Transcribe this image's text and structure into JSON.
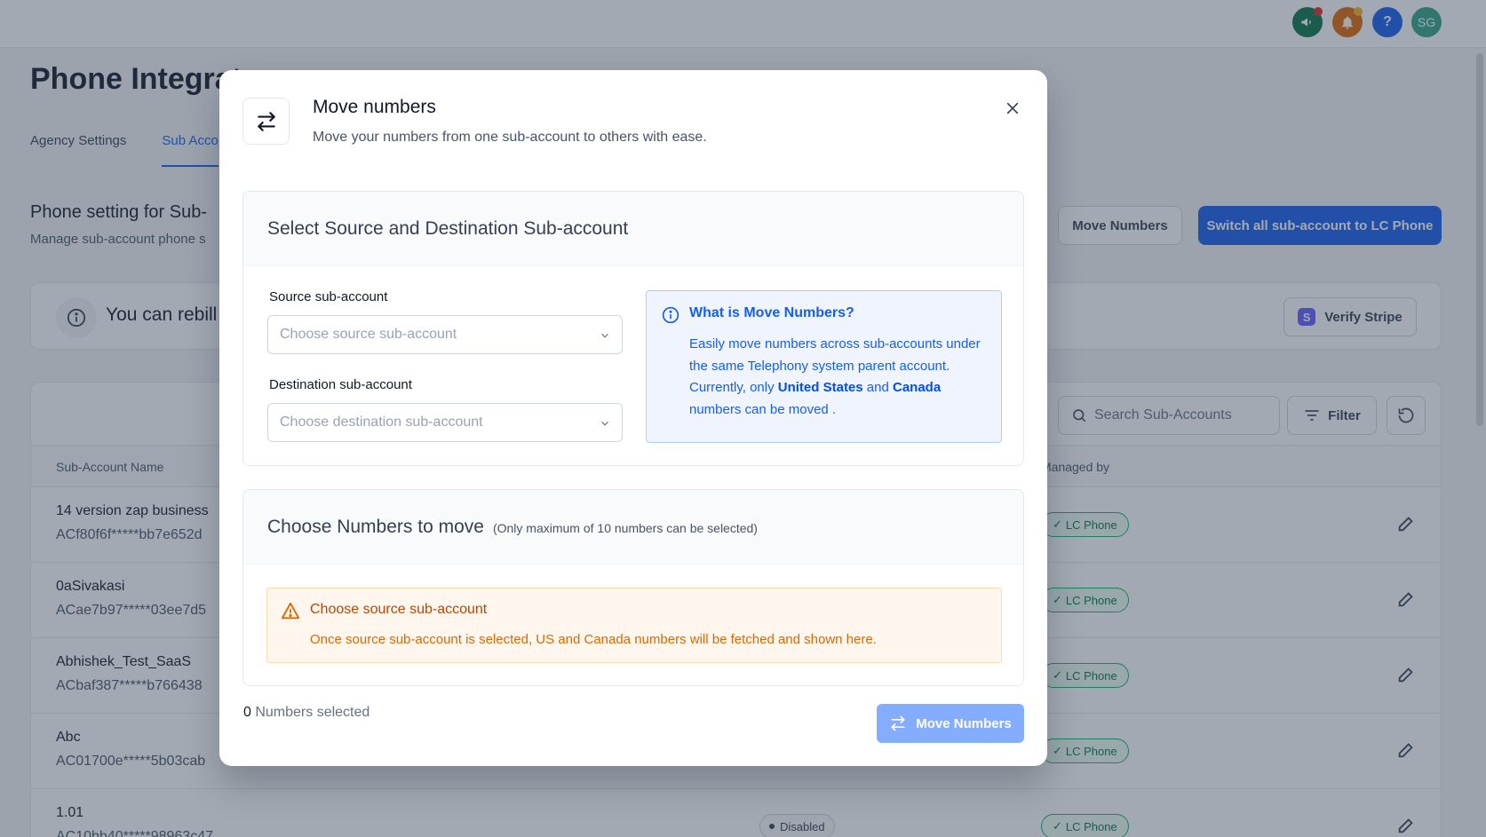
{
  "background": {
    "page_title": "Phone Integrat",
    "tabs": [
      {
        "label": "Agency Settings"
      },
      {
        "label": "Sub Acco"
      }
    ],
    "section_title": "Phone setting for Sub-",
    "section_sub": "Manage sub-account phone s",
    "move_numbers_label": "Move Numbers",
    "switch_all_label": "Switch all sub-account to LC Phone",
    "banner_text": "You can rebill",
    "verify_stripe_label": "Verify Stripe",
    "search_placeholder": "Search Sub-Accounts",
    "filter_label": "Filter",
    "table": {
      "col_name": "Sub-Account Name",
      "col_managed": "Managed by",
      "rows": [
        {
          "name": "14 version zap business",
          "sid": "ACf80f6f*****bb7e652d",
          "managed": "LC Phone"
        },
        {
          "name": "0aSivakasi",
          "sid": "ACae7b97*****03ee7d5",
          "managed": "LC Phone"
        },
        {
          "name": "Abhishek_Test_SaaS",
          "sid": "ACbaf387*****b766438",
          "managed": "LC Phone"
        },
        {
          "name": "Abc",
          "sid": "AC01700e*****5b03cab",
          "managed": "LC Phone"
        },
        {
          "name": "1.01",
          "sid": "AC10bb40*****98963c47",
          "managed": "LC Phone",
          "status": "Disabled"
        }
      ]
    },
    "avatar_initials": "SG",
    "help_glyph": "?"
  },
  "modal": {
    "title": "Move numbers",
    "subtitle": "Move your numbers from one sub-account to others with ease.",
    "select_section": {
      "title": "Select Source and Destination Sub-account",
      "source_label": "Source sub-account",
      "source_placeholder": "Choose source sub-account",
      "destination_label": "Destination sub-account",
      "destination_placeholder": "Choose destination sub-account"
    },
    "info": {
      "title": "What is Move Numbers?",
      "line1": "Easily move numbers across sub-accounts under the same Telephony system parent account. Currently, only ",
      "country1": "United States",
      "and_text": " and ",
      "country2": "Canada",
      "line2": " numbers can be moved ."
    },
    "numbers_section": {
      "title": "Choose Numbers to move",
      "note": "(Only maximum of 10 numbers can be selected)",
      "warning_title": "Choose source sub-account",
      "warning_body": "Once source sub-account is selected, US and Canada numbers will be fetched and shown here."
    },
    "selected_count": "0",
    "selected_label": " Numbers selected",
    "move_button_label": "Move Numbers"
  },
  "colors": {
    "primary": "#155eef",
    "primary_disabled": "#84adff",
    "warning": "#dc6803",
    "success": "#12b76a"
  }
}
